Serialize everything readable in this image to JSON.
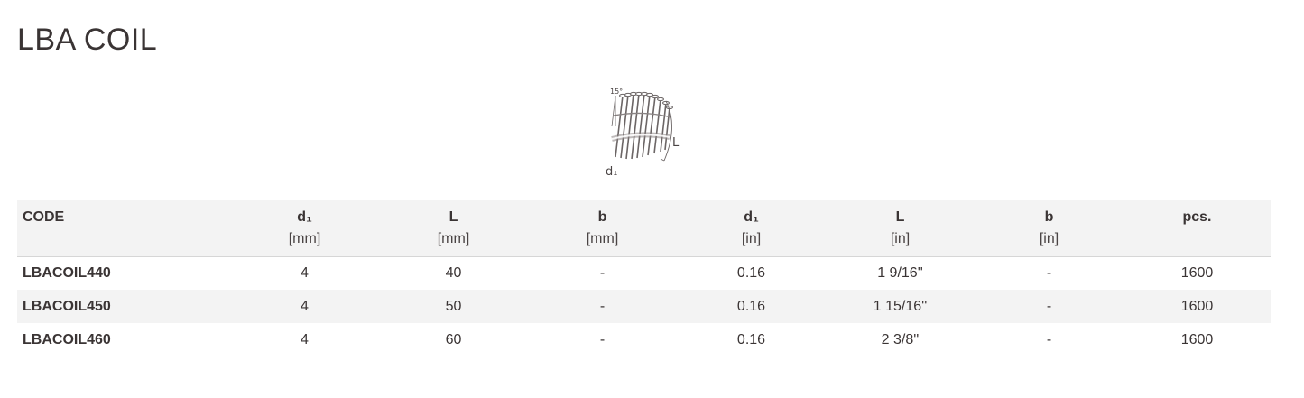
{
  "page": {
    "title": "LBA COIL"
  },
  "figure": {
    "angle_label": "15°",
    "length_label": "L",
    "diameter_label": "d₁"
  },
  "table": {
    "headers": [
      {
        "symbol": "CODE",
        "unit": ""
      },
      {
        "symbol": "d₁",
        "unit": "[mm]"
      },
      {
        "symbol": "L",
        "unit": "[mm]"
      },
      {
        "symbol": "b",
        "unit": "[mm]"
      },
      {
        "symbol": "d₁",
        "unit": "[in]"
      },
      {
        "symbol": "L",
        "unit": "[in]"
      },
      {
        "symbol": "b",
        "unit": "[in]"
      },
      {
        "symbol": "pcs.",
        "unit": ""
      }
    ],
    "rows": [
      [
        "LBACOIL440",
        "4",
        "40",
        "-",
        "0.16",
        "1 9/16''",
        "-",
        "1600"
      ],
      [
        "LBACOIL450",
        "4",
        "50",
        "-",
        "0.16",
        "1 15/16''",
        "-",
        "1600"
      ],
      [
        "LBACOIL460",
        "4",
        "60",
        "-",
        "0.16",
        "2 3/8''",
        "-",
        "1600"
      ]
    ]
  }
}
